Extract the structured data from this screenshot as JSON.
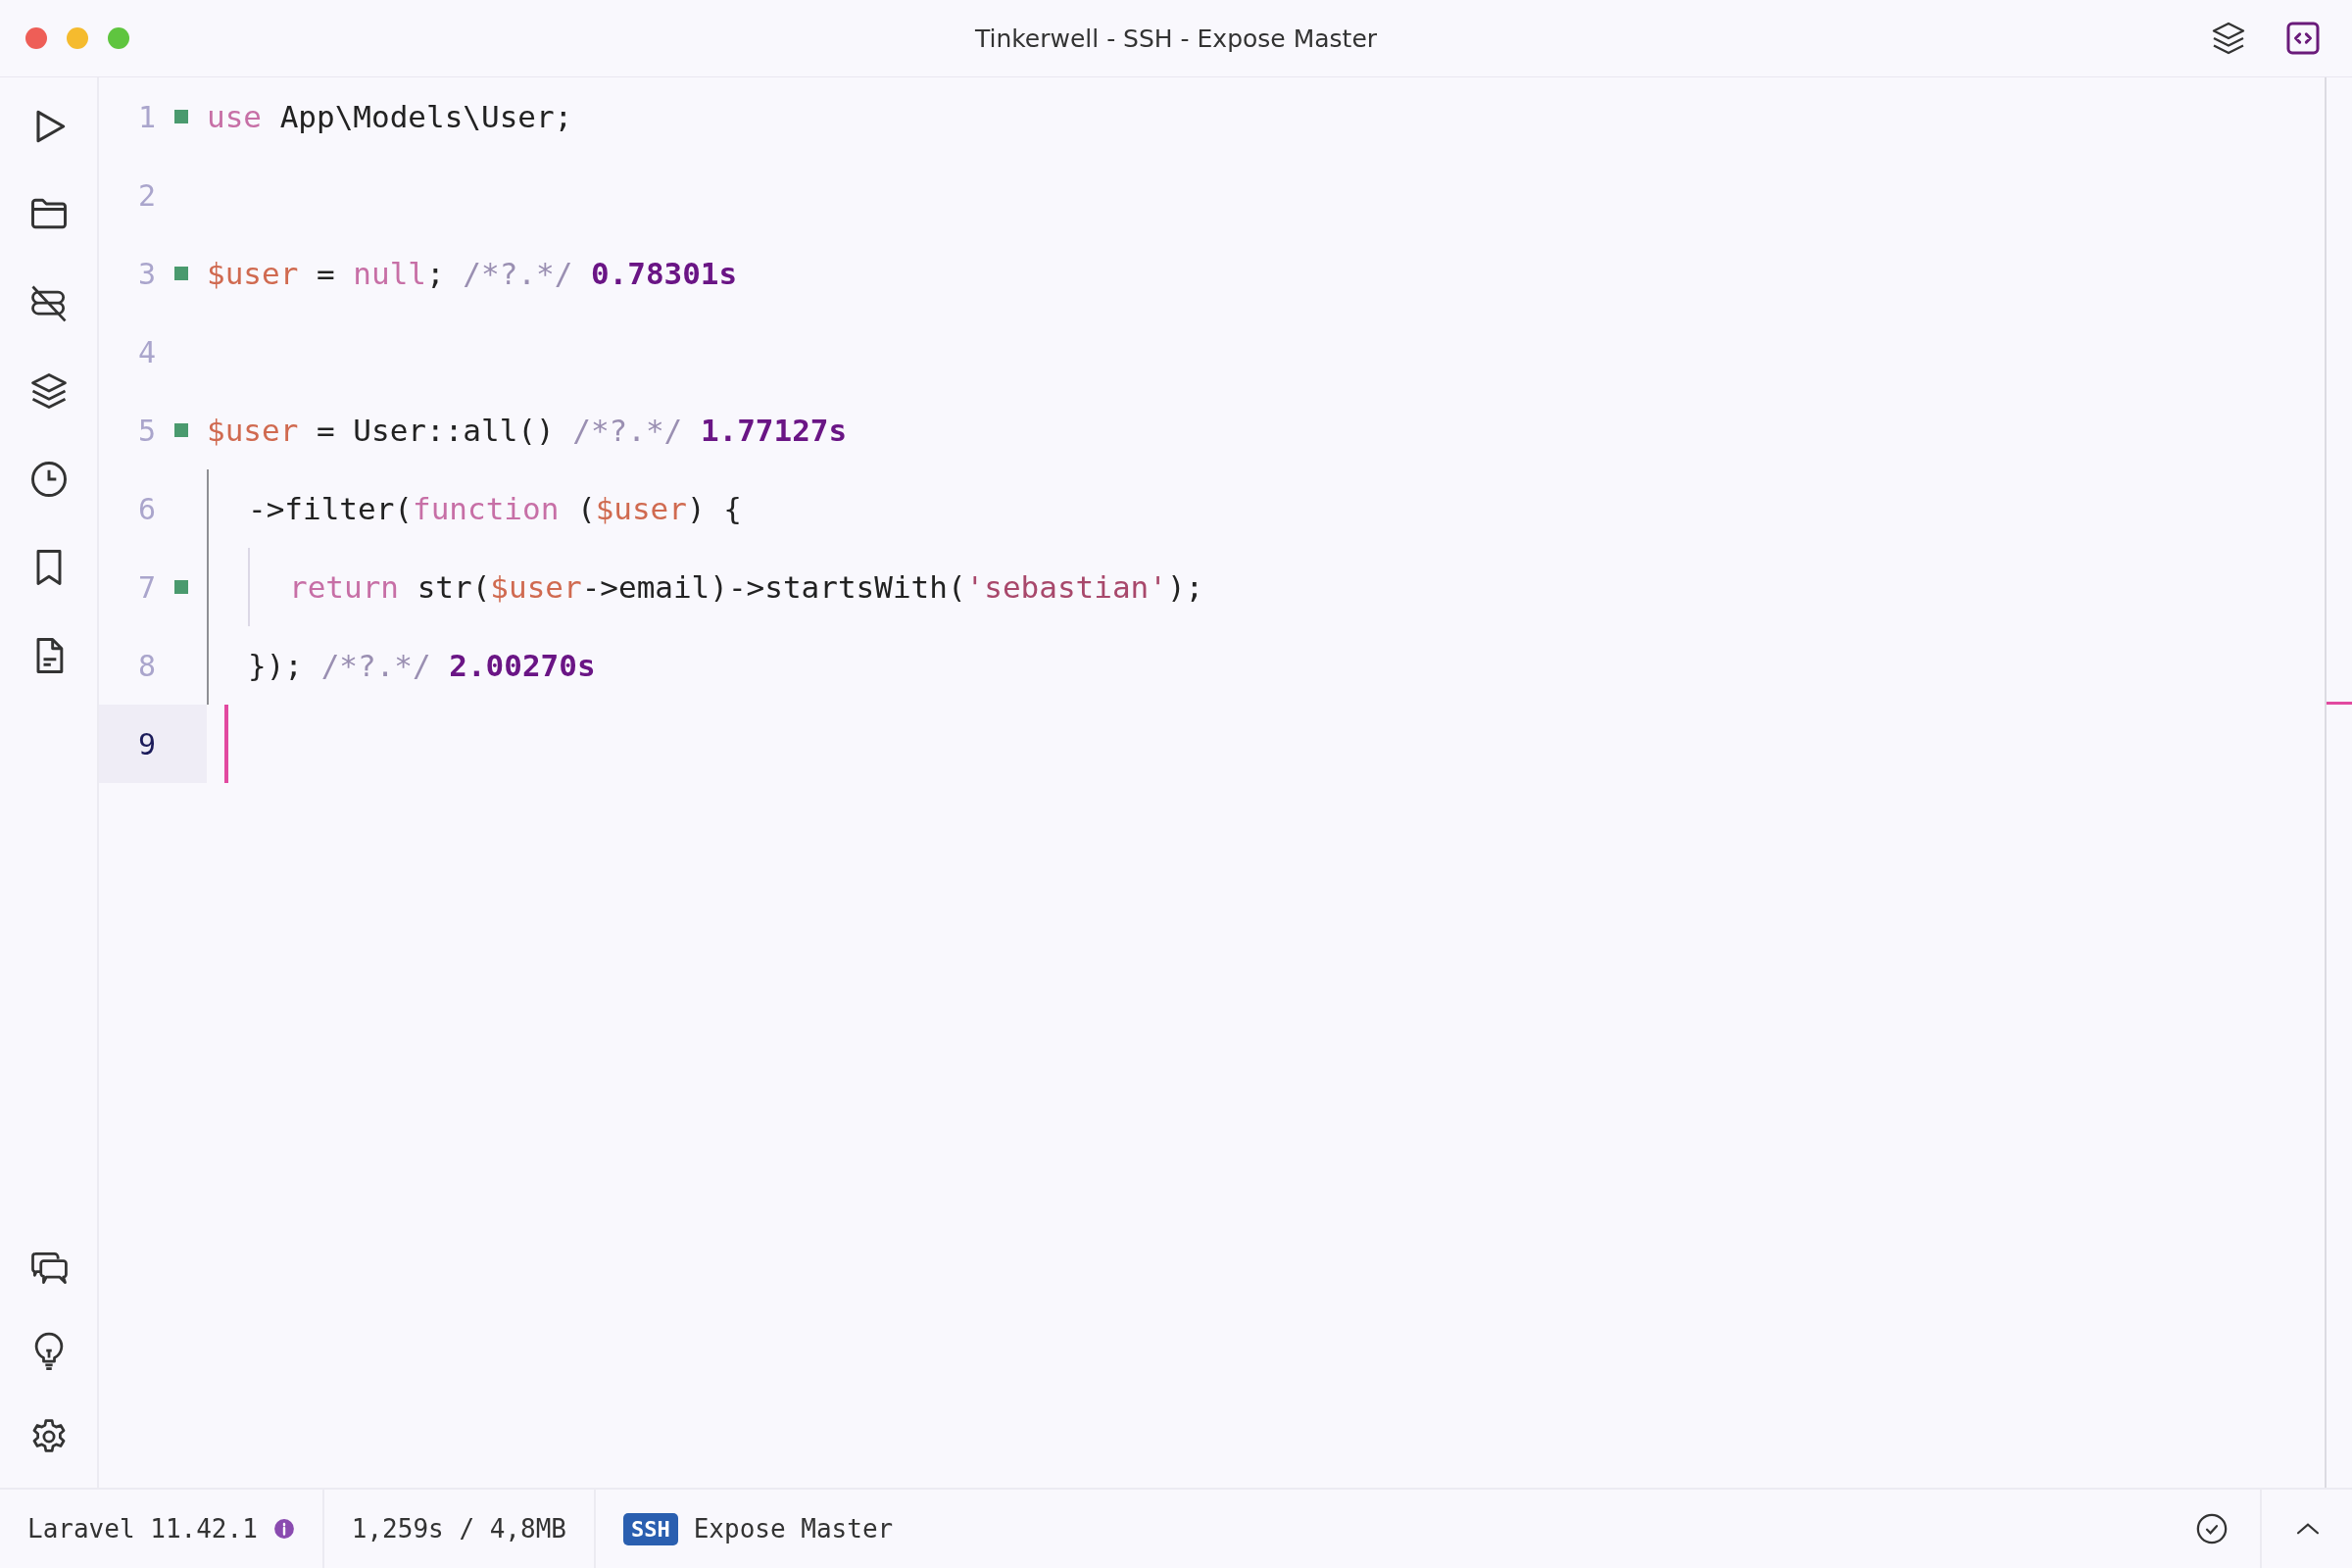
{
  "window": {
    "title": "Tinkerwell - SSH - Expose Master"
  },
  "code_lines": [
    {
      "kind": "line",
      "number": "1",
      "marker": true,
      "current": false,
      "tokens": [
        {
          "kind": "keyword",
          "text": "use"
        },
        {
          "kind": "plain",
          "text": " App\\Models\\User;"
        }
      ]
    },
    {
      "kind": "line",
      "number": "2",
      "marker": false,
      "current": false
    },
    {
      "kind": "line",
      "number": "3",
      "marker": true,
      "current": false,
      "tokens": [
        {
          "kind": "variable",
          "text": "$user"
        },
        {
          "kind": "plain",
          "text": " = "
        },
        {
          "kind": "keyword",
          "text": "null"
        },
        {
          "kind": "plain",
          "text": "; "
        },
        {
          "kind": "comment",
          "text": "/*?.*/"
        },
        {
          "kind": "result",
          "text": "0.78301s"
        }
      ]
    },
    {
      "kind": "line",
      "number": "4",
      "marker": false,
      "current": false
    },
    {
      "kind": "line",
      "number": "5",
      "marker": true,
      "current": false,
      "tokens": [
        {
          "kind": "variable",
          "text": "$user"
        },
        {
          "kind": "plain",
          "text": " = User::all() "
        },
        {
          "kind": "comment",
          "text": "/*?.*/"
        },
        {
          "kind": "result",
          "text": "1.77127s"
        }
      ]
    },
    {
      "kind": "block",
      "children": [
        {
          "kind": "line",
          "number": "6",
          "marker": false,
          "current": false,
          "tokens": [
            {
              "kind": "plain",
              "text": "->filter("
            },
            {
              "kind": "keyword",
              "text": "function"
            },
            {
              "kind": "plain",
              "text": " ("
            },
            {
              "kind": "variable",
              "text": "$user"
            },
            {
              "kind": "plain",
              "text": ") {"
            }
          ]
        },
        {
          "kind": "block",
          "children": [
            {
              "kind": "line",
              "number": "7",
              "marker": true,
              "current": false,
              "tokens": [
                {
                  "kind": "keyword",
                  "text": "return"
                },
                {
                  "kind": "plain",
                  "text": " str("
                },
                {
                  "kind": "variable",
                  "text": "$user"
                },
                {
                  "kind": "plain",
                  "text": "->email)->startsWith("
                },
                {
                  "kind": "string",
                  "text": "'sebastian'"
                },
                {
                  "kind": "plain",
                  "text": ");"
                }
              ]
            }
          ]
        },
        {
          "kind": "line",
          "number": "8",
          "marker": false,
          "current": false,
          "tokens": [
            {
              "kind": "plain",
              "text": "}); "
            },
            {
              "kind": "comment",
              "text": "/*?.*/"
            },
            {
              "kind": "result",
              "text": "2.00270s"
            }
          ]
        }
      ]
    },
    {
      "kind": "line",
      "number": "9",
      "marker": false,
      "current": true
    }
  ],
  "status_bar": {
    "framework": "Laravel 11.42.1",
    "stats": "1,259s / 4,8MB",
    "connection_badge": "SSH",
    "connection_name": "Expose Master"
  }
}
